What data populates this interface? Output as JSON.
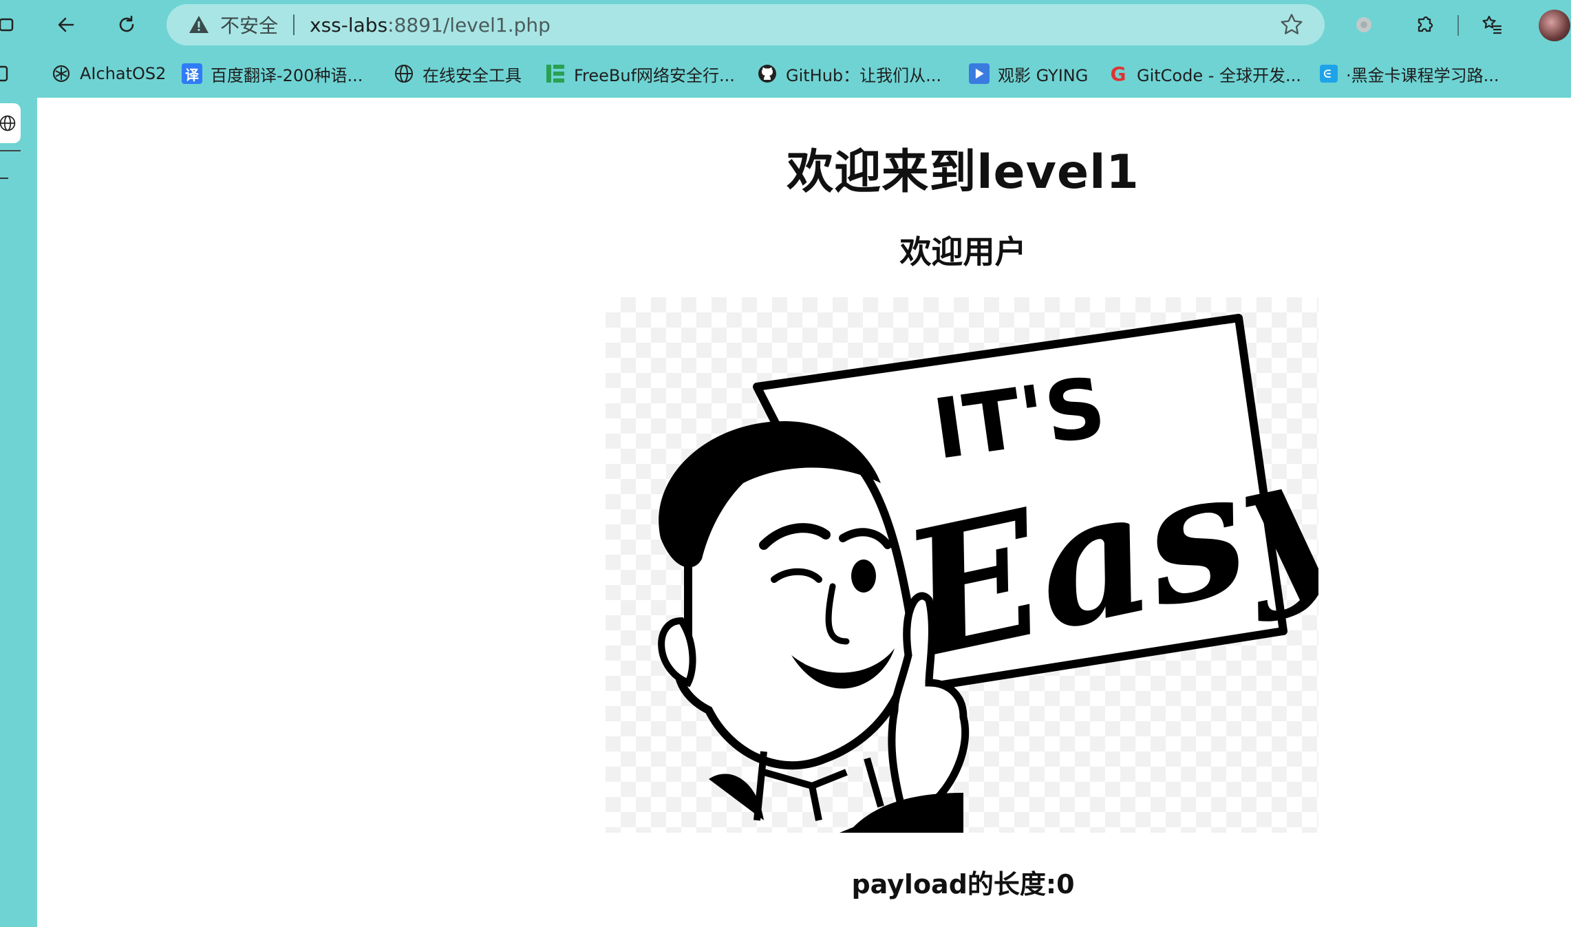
{
  "browser": {
    "security_label": "不安全",
    "url_host": "xss-labs",
    "url_rest": ":8891/level1.php",
    "bookmarks": [
      {
        "label": "AIchatOS2",
        "icon": "chatgpt-icon"
      },
      {
        "label": "百度翻译-200种语...",
        "icon": "translate-icon",
        "icon_text": "译",
        "color": "#2f7cf6"
      },
      {
        "label": "在线安全工具",
        "icon": "globe-icon"
      },
      {
        "label": "FreeBuf网络安全行...",
        "icon": "freebuf-icon",
        "color": "#2aa052"
      },
      {
        "label": "GitHub：让我们从...",
        "icon": "github-icon"
      },
      {
        "label": "观影 GYING",
        "icon": "play-icon",
        "color": "#3a7be0"
      },
      {
        "label": "GitCode - 全球开发...",
        "icon": "gitcode-icon",
        "icon_text": "G",
        "color": "#e0332f"
      },
      {
        "label": "·黑金卡课程学习路...",
        "icon": "course-icon",
        "color": "#1fa3e8"
      }
    ]
  },
  "page": {
    "title": "欢迎来到level1",
    "subtitle": "欢迎用户",
    "image_text": {
      "line1": "IT'S",
      "line2": "Easy"
    },
    "payload_text": "payload的长度:0"
  }
}
